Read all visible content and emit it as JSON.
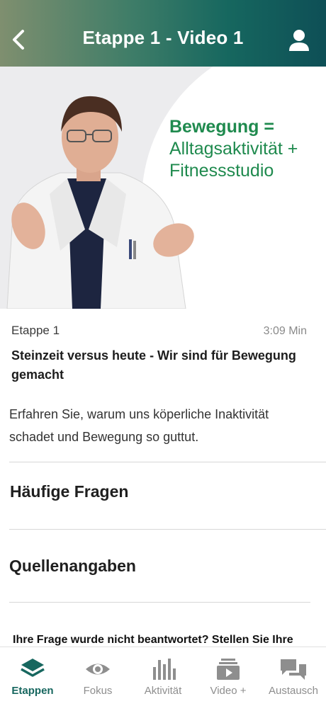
{
  "header": {
    "title": "Etappe 1 - Video 1"
  },
  "video": {
    "slide_bold": "Bewegung =",
    "slide_line2": "Alltagsaktivität +",
    "slide_line3": "Fitnessstudio"
  },
  "episode": {
    "stage": "Etappe 1",
    "duration": "3:09 Min",
    "title": "Steinzeit versus heute - Wir sind für Bewegung gemacht",
    "description": "Erfahren Sie, warum uns köperliche Inaktivität schadet und Bewegung so guttut."
  },
  "sections": {
    "faq": "Häufige Fragen",
    "sources": "Quellenangaben"
  },
  "question_prompt": "Ihre Frage wurde nicht beantwortet? Stellen Sie Ihre",
  "tabs": [
    {
      "label": "Etappen",
      "icon": "layers-icon",
      "active": true
    },
    {
      "label": "Fokus",
      "icon": "eye-icon",
      "active": false
    },
    {
      "label": "Aktivität",
      "icon": "bars-icon",
      "active": false
    },
    {
      "label": "Video +",
      "icon": "video-stack-icon",
      "active": false
    },
    {
      "label": "Austausch",
      "icon": "chat-icon",
      "active": false
    }
  ],
  "colors": {
    "accent": "#17675f",
    "slide_green": "#1f8a4e",
    "inactive": "#8e8e8e"
  }
}
